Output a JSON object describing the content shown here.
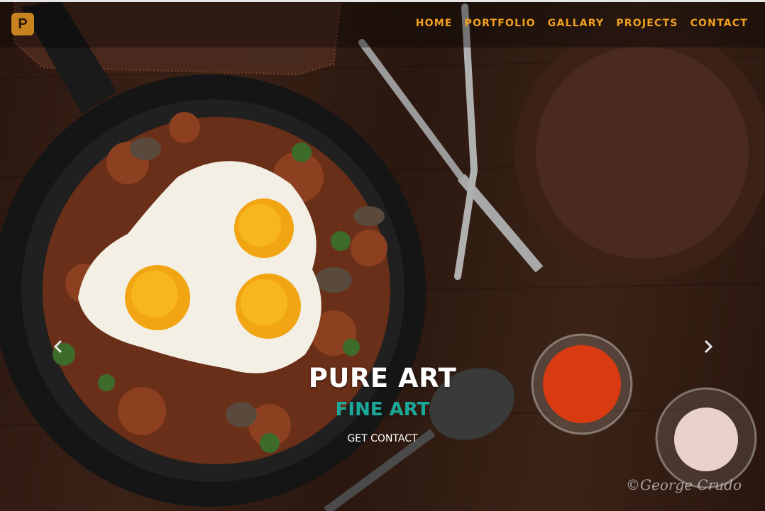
{
  "brand": {
    "logo_letter": "P"
  },
  "nav": {
    "items": [
      "HOME",
      "PORTFOLIO",
      "GALLARY",
      "PROJECTS",
      "CONTACT"
    ]
  },
  "carousel": {
    "prev_icon": "chevron-left-icon",
    "next_icon": "chevron-right-icon"
  },
  "hero": {
    "title": "PURE ART",
    "subtitle": "FINE ART",
    "cta": "GET CONTACT"
  },
  "photo": {
    "signature": "©George Crudo"
  },
  "colors": {
    "nav_accent": "#f0a020",
    "subtitle": "#1aa89a",
    "logo_bg": "#c8831f"
  }
}
